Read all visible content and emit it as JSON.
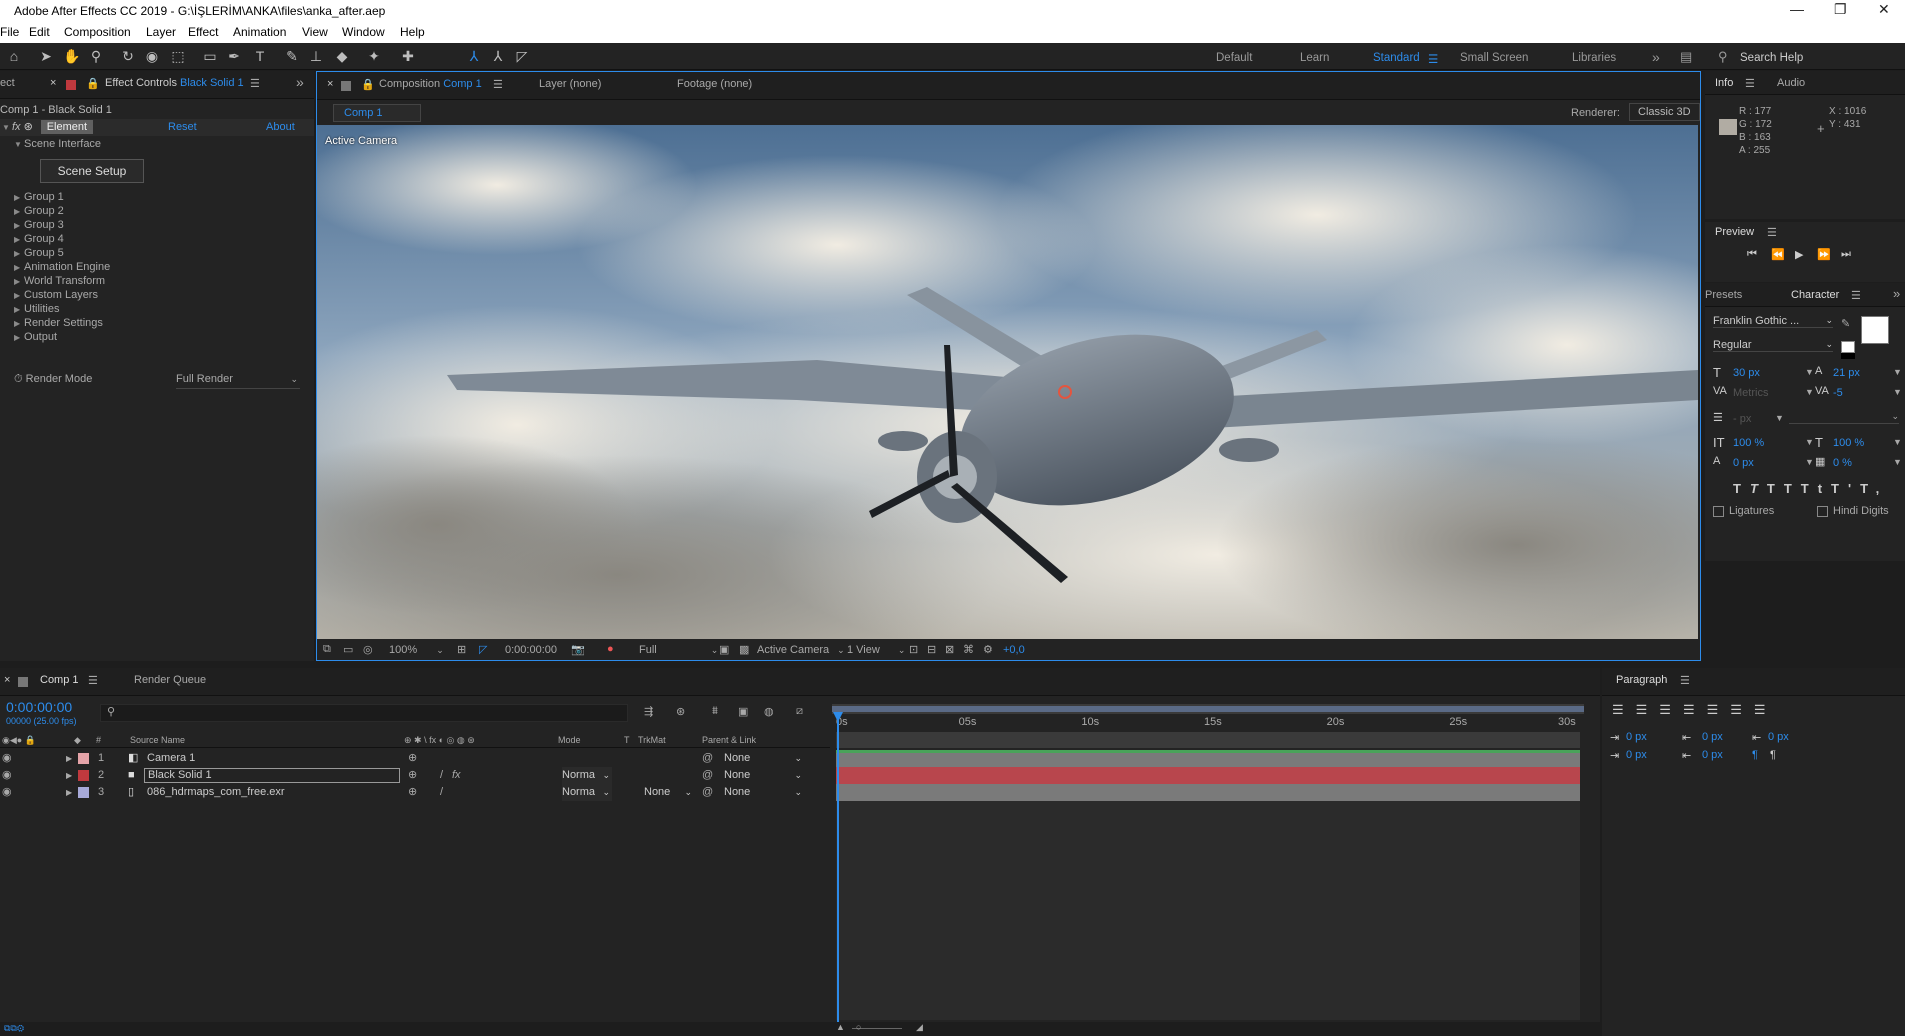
{
  "window": {
    "title": "Adobe After Effects CC 2019 - G:\\İŞLERİM\\ANKA\\files\\anka_after.aep"
  },
  "menu": [
    "File",
    "Edit",
    "Composition",
    "Layer",
    "Effect",
    "Animation",
    "View",
    "Window",
    "Help"
  ],
  "workspaces": {
    "default": "Default",
    "learn": "Learn",
    "standard": "Standard",
    "small": "Small Screen",
    "libraries": "Libraries",
    "search": "Search Help"
  },
  "effect_controls": {
    "tab_prefix": "ect",
    "tab_label": "Effect Controls",
    "tab_layer": "Black Solid 1",
    "path": "Comp 1 - Black Solid 1",
    "effect_name": "Element",
    "reset": "Reset",
    "about": "About",
    "scene_interface": "Scene Interface",
    "scene_setup": "Scene Setup",
    "groups": [
      "Group 1",
      "Group 2",
      "Group 3",
      "Group 4",
      "Group 5",
      "Animation Engine",
      "World Transform",
      "Custom Layers",
      "Utilities",
      "Render Settings",
      "Output"
    ],
    "render_mode_label": "Render Mode",
    "render_mode_value": "Full Render"
  },
  "composition": {
    "tab_label": "Composition",
    "tab_comp": "Comp 1",
    "layer_tab": "Layer (none)",
    "footage_tab": "Footage (none)",
    "subtab": "Comp 1",
    "renderer_label": "Renderer:",
    "renderer_value": "Classic 3D",
    "viewer_label": "Active Camera",
    "zoom": "100%",
    "timecode": "0:00:00:00",
    "resolution": "Full",
    "camera": "Active Camera",
    "views": "1 View",
    "exposure": "+0,0"
  },
  "info": {
    "tab": "Info",
    "audio_tab": "Audio",
    "r": "R : 177",
    "g": "G : 172",
    "b": "B : 163",
    "a": "A : 255",
    "x": "X : 1016",
    "y": "Y : 431",
    "swatch": "#b1aca3"
  },
  "preview": {
    "tab": "Preview"
  },
  "character": {
    "presets_tab": "Presets",
    "tab": "Character",
    "font": "Franklin Gothic ...",
    "style": "Regular",
    "size": "30 px",
    "leading": "21 px",
    "kerning": "Metrics",
    "tracking": "-5",
    "stroke": "- px",
    "vscale": "100 %",
    "hscale": "100 %",
    "baseline": "0 px",
    "tsume": "0 %",
    "ligatures": "Ligatures",
    "hindi": "Hindi Digits"
  },
  "paragraph": {
    "tab": "Paragraph",
    "v1": "0 px",
    "v2": "0 px",
    "v3": "0 px",
    "v4": "0 px",
    "v5": "0 px"
  },
  "timeline": {
    "tab": "Comp 1",
    "render_queue": "Render Queue",
    "timecode": "0:00:00:00",
    "fps": "00000 (25.00 fps)",
    "cols": {
      "source": "Source Name",
      "mode": "Mode",
      "t": "T",
      "trkmat": "TrkMat",
      "parent": "Parent & Link"
    },
    "layers": [
      {
        "num": "1",
        "name": "Camera 1",
        "color": "#e4a3a8",
        "mode": "",
        "trkmat": "",
        "parent": "None"
      },
      {
        "num": "2",
        "name": "Black Solid 1",
        "color": "#c0393e",
        "mode": "Norma",
        "trkmat": "",
        "parent": "None"
      },
      {
        "num": "3",
        "name": "086_hdrmaps_com_free.exr",
        "color": "#a7a9d8",
        "mode": "Norma",
        "trkmat": "None",
        "parent": "None"
      }
    ],
    "ruler": [
      "0s",
      "05s",
      "10s",
      "15s",
      "20s",
      "25s",
      "30s"
    ]
  },
  "colors": {
    "accent": "#2d8ceb",
    "bar_red": "#b8464d",
    "bar_gray": "#7a7a7a",
    "bar_green": "#4aa35a"
  }
}
